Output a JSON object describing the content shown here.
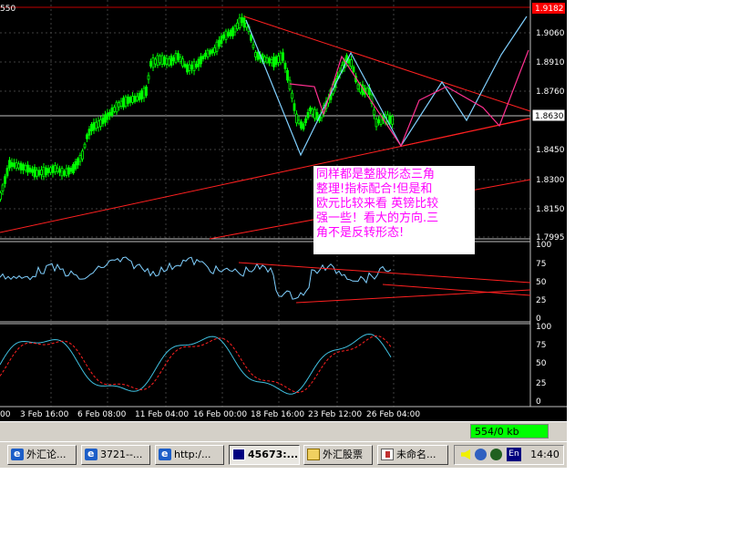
{
  "chart": {
    "top_left_label": "550",
    "price_ticks": [
      "1.9060",
      "1.8910",
      "1.8760",
      "1.8630",
      "1.8450",
      "1.8300",
      "1.8150",
      "1.7995"
    ],
    "current_price": "1.8630",
    "high_price": "1.9182",
    "rsi_ticks": [
      "100",
      "75",
      "50",
      "25",
      "0"
    ],
    "stoch_ticks": [
      "100",
      "75",
      "50",
      "25",
      "0"
    ],
    "time_labels": [
      "00",
      "3 Feb 16:00",
      "6 Feb 08:00",
      "11 Feb 04:00",
      "16 Feb 00:00",
      "18 Feb 16:00",
      "23 Feb 12:00",
      "26 Feb 04:00"
    ],
    "colors": {
      "background": "#000000",
      "candle": "#00ff00",
      "trendline": "#ff2020",
      "forecast_blue": "#80d0ff",
      "forecast_magenta": "#ff3090",
      "grid": "#404040"
    }
  },
  "annotation": {
    "lines": [
      "同样都是整股形态三角",
      "整理!指标配合!但是和",
      "欧元比较来看  英镑比较",
      "强一些！看大的方向.三",
      "角不是反转形态!"
    ]
  },
  "status": {
    "download": "554/0 kb"
  },
  "taskbar": {
    "items": [
      {
        "label": "外汇论...",
        "icon": "ie-icon"
      },
      {
        "label": "3721--...",
        "icon": "ie-icon"
      },
      {
        "label": "http:/...",
        "icon": "ie-icon"
      },
      {
        "label": "45673:...",
        "icon": "chart-icon"
      },
      {
        "label": "外汇股票",
        "icon": "folder-icon"
      },
      {
        "label": "未命名...",
        "icon": "paint-icon"
      }
    ],
    "tray": {
      "lang": "En",
      "clock": "14:40"
    }
  }
}
